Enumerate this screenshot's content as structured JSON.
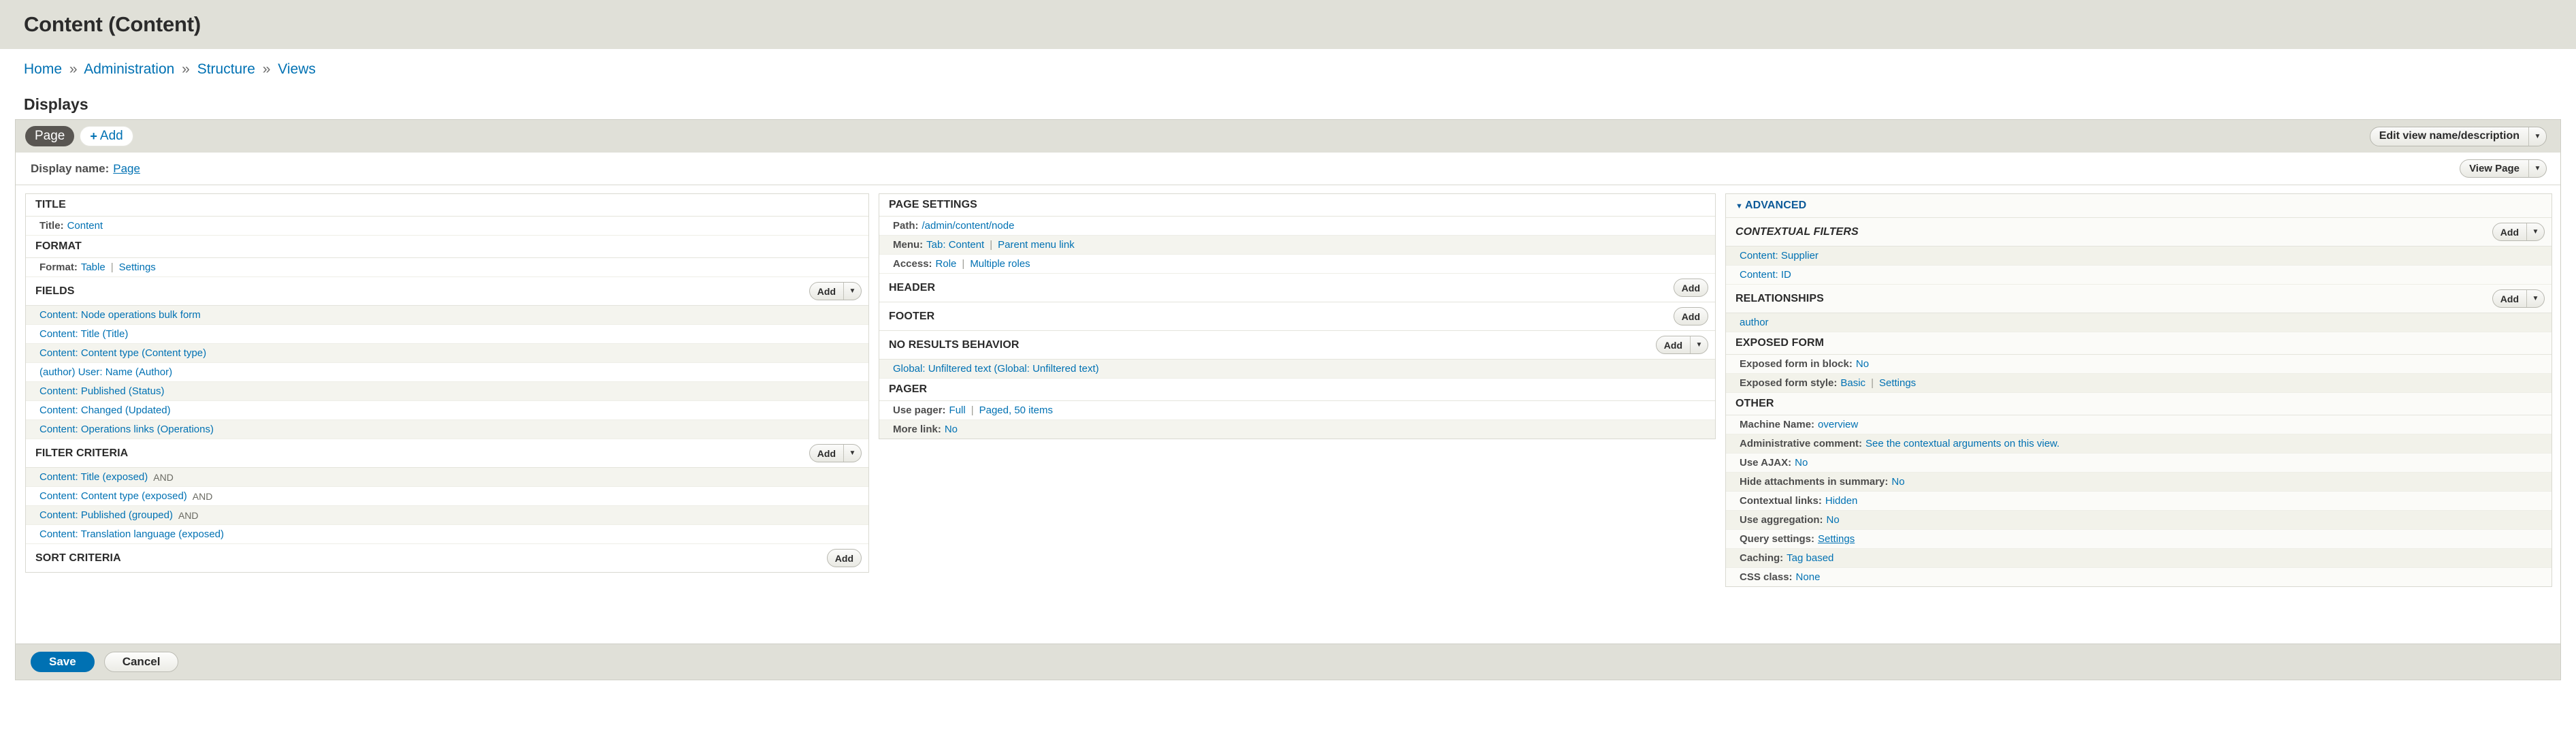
{
  "header": {
    "title": "Content (Content)"
  },
  "breadcrumb": {
    "separator": "»",
    "items": [
      "Home",
      "Administration",
      "Structure",
      "Views"
    ]
  },
  "displays": {
    "heading": "Displays",
    "tabs": [
      {
        "label": "Page",
        "active": true
      },
      {
        "label": "Add",
        "active": false,
        "icon": "plus-icon"
      }
    ],
    "edit_view_button": {
      "label": "Edit view name/description",
      "arrow": "▼"
    },
    "display_name": {
      "label": "Display name:",
      "value": "Page"
    },
    "view_page_button": {
      "label": "View Page",
      "arrow": "▼"
    }
  },
  "column_left": {
    "title_section": {
      "heading": "TITLE",
      "rows": [
        {
          "key": "Title:",
          "value": "Content"
        }
      ]
    },
    "format_section": {
      "heading": "FORMAT",
      "rows": [
        {
          "key": "Format:",
          "value": "Table",
          "divider": "|",
          "value2": "Settings"
        }
      ]
    },
    "fields_section": {
      "heading": "FIELDS",
      "add_label": "Add",
      "add_arrow": "▼",
      "items": [
        "Content: Node operations bulk form",
        "Content: Title (Title)",
        "Content: Content type (Content type)",
        "(author) User: Name (Author)",
        "Content: Published (Status)",
        "Content: Changed (Updated)",
        "Content: Operations links (Operations)"
      ]
    },
    "filter_section": {
      "heading": "FILTER CRITERIA",
      "add_label": "Add",
      "add_arrow": "▼",
      "items": [
        {
          "label": "Content: Title (exposed)",
          "op": "AND"
        },
        {
          "label": "Content: Content type (exposed)",
          "op": "AND"
        },
        {
          "label": "Content: Published (grouped)",
          "op": "AND"
        },
        {
          "label": "Content: Translation language (exposed)",
          "op": ""
        }
      ]
    },
    "sort_section": {
      "heading": "SORT CRITERIA",
      "add_label": "Add"
    }
  },
  "column_middle": {
    "page_settings": {
      "heading": "PAGE SETTINGS",
      "rows": [
        {
          "key": "Path:",
          "value": "/admin/content/node"
        },
        {
          "key": "Menu:",
          "value": "Tab: Content",
          "divider": "|",
          "value2": "Parent menu link"
        },
        {
          "key": "Access:",
          "value": "Role",
          "divider": "|",
          "value2": "Multiple roles"
        }
      ]
    },
    "header_section": {
      "heading": "HEADER",
      "add_label": "Add"
    },
    "footer_section": {
      "heading": "FOOTER",
      "add_label": "Add"
    },
    "no_results_section": {
      "heading": "NO RESULTS BEHAVIOR",
      "add_label": "Add",
      "add_arrow": "▼",
      "items": [
        "Global: Unfiltered text (Global: Unfiltered text)"
      ]
    },
    "pager_section": {
      "heading": "PAGER",
      "rows": [
        {
          "key": "Use pager:",
          "value": "Full",
          "divider": "|",
          "value2": "Paged, 50 items"
        },
        {
          "key": "More link:",
          "value": "No"
        }
      ]
    }
  },
  "column_right": {
    "advanced": {
      "label": "ADVANCED",
      "caret": "▼"
    },
    "contextual_filters": {
      "heading": "CONTEXTUAL FILTERS",
      "add_label": "Add",
      "add_arrow": "▼",
      "items": [
        "Content: Supplier",
        "Content: ID"
      ]
    },
    "relationships": {
      "heading": "RELATIONSHIPS",
      "add_label": "Add",
      "add_arrow": "▼",
      "items": [
        "author"
      ]
    },
    "exposed_form": {
      "heading": "EXPOSED FORM",
      "rows": [
        {
          "key": "Exposed form in block:",
          "value": "No"
        },
        {
          "key": "Exposed form style:",
          "value": "Basic",
          "divider": "|",
          "value2": "Settings"
        }
      ]
    },
    "other": {
      "heading": "OTHER",
      "rows": [
        {
          "key": "Machine Name:",
          "value": "overview"
        },
        {
          "key": "Administrative comment:",
          "value": "See the contextual arguments on this view."
        },
        {
          "key": "Use AJAX:",
          "value": "No"
        },
        {
          "key": "Hide attachments in summary:",
          "value": "No"
        },
        {
          "key": "Contextual links:",
          "value": "Hidden"
        },
        {
          "key": "Use aggregation:",
          "value": "No"
        },
        {
          "key": "Query settings:",
          "value": "Settings",
          "underline": true
        },
        {
          "key": "Caching:",
          "value": "Tag based"
        },
        {
          "key": "CSS class:",
          "value": "None"
        }
      ]
    }
  },
  "actions": {
    "save_label": "Save",
    "cancel_label": "Cancel"
  },
  "colors": {
    "link": "#0071b3",
    "header_bg": "#e0e0d8",
    "active_tab_bg": "#595652",
    "primary_button": "#0071b3"
  }
}
